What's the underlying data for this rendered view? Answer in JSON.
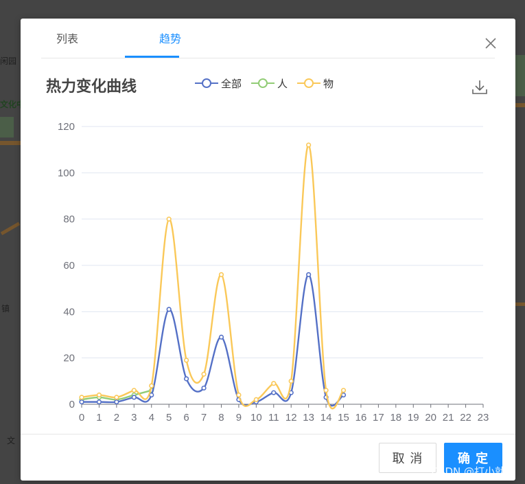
{
  "tabs": [
    {
      "label": "列表",
      "active": false
    },
    {
      "label": "趋势",
      "active": true
    }
  ],
  "chart_title": "热力变化曲线",
  "buttons": {
    "cancel": "取 消",
    "ok": "确 定"
  },
  "watermark": "CSDN @打小就霸",
  "map_labels": [
    "闲园",
    "文化中",
    "镇",
    "文"
  ],
  "colors": {
    "accent": "#1a8fff",
    "series_all": "#5470c6",
    "series_person": "#91cc75",
    "series_object": "#fac858"
  },
  "icons": [
    "close-icon",
    "download-icon"
  ],
  "chart_data": {
    "type": "line",
    "title": "热力变化曲线",
    "x": [
      "0",
      "1",
      "2",
      "3",
      "4",
      "5",
      "6",
      "7",
      "8",
      "9",
      "10",
      "11",
      "12",
      "13",
      "14",
      "15",
      "16",
      "17",
      "18",
      "19",
      "20",
      "21",
      "22",
      "23"
    ],
    "ylim": [
      0,
      120
    ],
    "yticks": [
      0,
      20,
      40,
      60,
      80,
      100,
      120
    ],
    "grid": true,
    "legend_position": "top",
    "series": [
      {
        "name": "全部",
        "color": "#5470c6",
        "values": [
          1,
          1,
          1,
          3,
          4,
          41,
          11,
          7,
          29,
          2,
          1,
          5,
          5,
          56,
          3,
          4
        ]
      },
      {
        "name": "人",
        "color": "#91cc75",
        "values": [
          2,
          3,
          2,
          4,
          6
        ]
      },
      {
        "name": "物",
        "color": "#fac858",
        "values": [
          3,
          4,
          3,
          6,
          8,
          80,
          19,
          13,
          56,
          4,
          2,
          9,
          10,
          112,
          6,
          6
        ]
      }
    ]
  }
}
